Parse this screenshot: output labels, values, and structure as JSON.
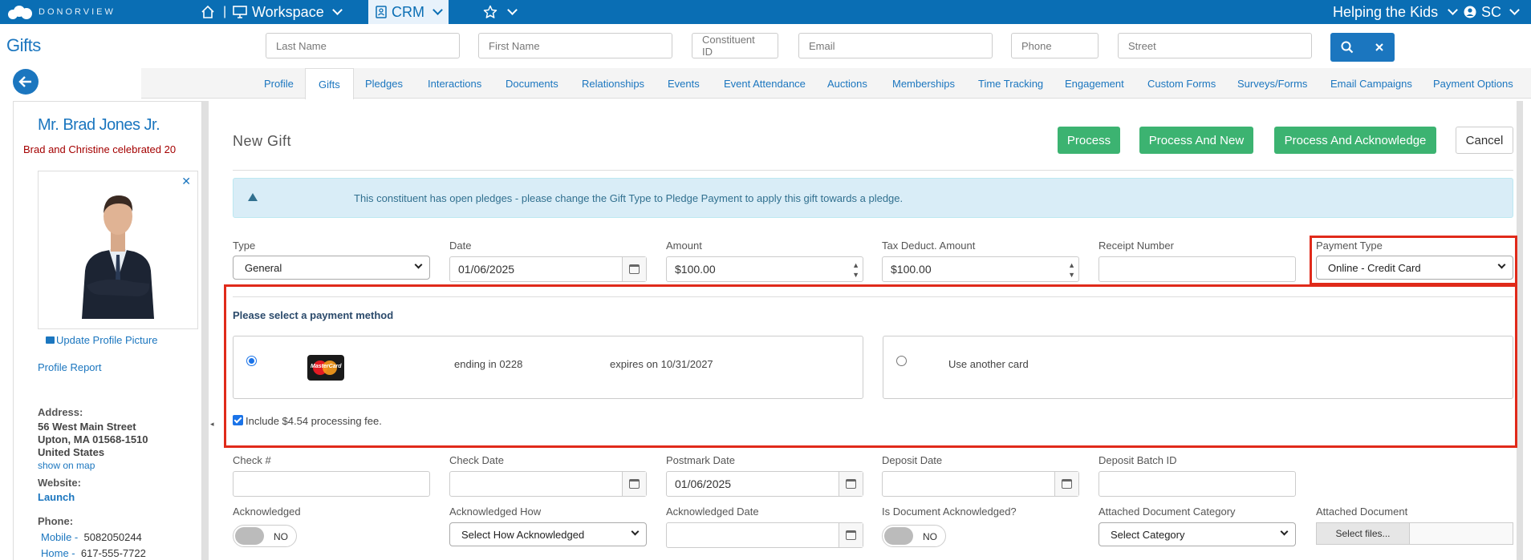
{
  "topbar": {
    "logo_text": "DONORVIEW",
    "workspace_label": "Workspace",
    "crm_label": "CRM",
    "org_label": "Helping the Kids",
    "user_initials": "SC"
  },
  "page_title": "Gifts",
  "search": {
    "last_name": "Last Name",
    "first_name": "First Name",
    "constituent_id": "Constituent ID",
    "email": "Email",
    "phone": "Phone",
    "street": "Street"
  },
  "tabs": [
    "Profile",
    "Gifts",
    "Pledges",
    "Interactions",
    "Documents",
    "Relationships",
    "Events",
    "Event Attendance",
    "Auctions",
    "Memberships",
    "Time Tracking",
    "Engagement",
    "Custom Forms",
    "Surveys/Forms",
    "Email Campaigns",
    "Payment Options"
  ],
  "constituent": {
    "name": "Mr. Brad Jones Jr.",
    "note": "Brad and Christine celebrated 20",
    "update_picture": "Update Profile Picture",
    "profile_report": "Profile Report",
    "address_label": "Address:",
    "address_line1": "56 West Main Street",
    "address_line2": "Upton, MA 01568-1510",
    "address_line3": "United States",
    "show_on_map": "show on map",
    "website_label": "Website:",
    "website_link": "Launch",
    "phone_label": "Phone:",
    "mobile_label": "Mobile -",
    "mobile": "5082050244",
    "home_label": "Home -",
    "home": "617-555-7722"
  },
  "form": {
    "title": "New Gift",
    "buttons": {
      "process": "Process",
      "process_new": "Process And New",
      "process_ack": "Process And Acknowledge",
      "cancel": "Cancel"
    },
    "alert": "This constituent has open pledges - please change the Gift Type to Pledge Payment to apply this gift towards a pledge.",
    "labels": {
      "type": "Type",
      "date": "Date",
      "amount": "Amount",
      "tax": "Tax Deduct. Amount",
      "receipt": "Receipt Number",
      "payment_type": "Payment Type",
      "check": "Check #",
      "check_date": "Check Date",
      "postmark": "Postmark Date",
      "deposit_date": "Deposit Date",
      "deposit_batch": "Deposit Batch ID",
      "acknowledged": "Acknowledged",
      "ack_how": "Acknowledged How",
      "ack_date": "Acknowledged Date",
      "doc_ack": "Is Document Acknowledged?",
      "doc_category": "Attached Document Category",
      "attached_doc": "Attached Document"
    },
    "values": {
      "type": "General",
      "date": "01/06/2025",
      "amount": "$100.00",
      "tax": "$100.00",
      "receipt": "",
      "payment_type": "Online - Credit Card",
      "postmark": "01/06/2025",
      "ack_how": "Select How Acknowledged",
      "doc_category": "Select Category",
      "file_button": "Select files...",
      "toggle_no": "NO"
    },
    "payment": {
      "title": "Please select a payment method",
      "card_brand": "MasterCard",
      "ending": "ending in 0228",
      "expires": "expires on 10/31/2027",
      "other_card": "Use another card",
      "fee_label": "Include $4.54 processing fee."
    }
  },
  "colors": {
    "brand_blue": "#0a6eb4",
    "green": "#3cb371",
    "highlight_red": "#e02a1a"
  }
}
